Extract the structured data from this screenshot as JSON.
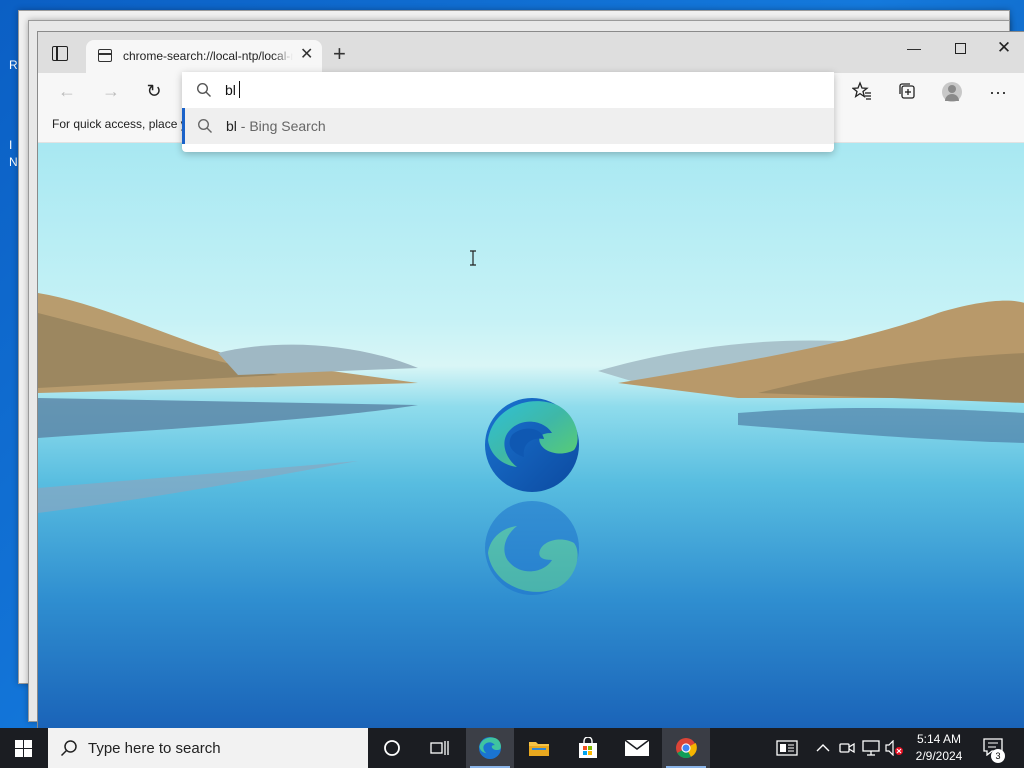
{
  "desktop": {
    "edge_letters": [
      "R",
      "I",
      "N"
    ]
  },
  "browser": {
    "tab": {
      "title": "chrome-search://local-ntp/local-ntp.html",
      "close": "✕"
    },
    "new_tab": "+",
    "window_controls": {
      "minimize": "—",
      "close": "✕"
    },
    "toolbar": {
      "back": "←",
      "forward": "→",
      "refresh": "↻",
      "more": "···"
    },
    "favbar_text": "For quick access, place y",
    "address_bar": {
      "value": "bl"
    },
    "suggestion": {
      "query": "bl",
      "description": " - Bing Search"
    }
  },
  "taskbar": {
    "search_placeholder": "Type here to search",
    "clock": {
      "time": "5:14 AM",
      "date": "2/9/2024"
    },
    "notification_count": "3"
  },
  "colors": {
    "accent": "#1a62c9",
    "taskbar_bg": "#1b1d22",
    "edge_blue": "#1a74d1",
    "edge_green": "#4cc36a"
  },
  "icons": [
    "tab-actions-icon",
    "page-icon",
    "search-icon",
    "back-icon",
    "forward-icon",
    "refresh-icon",
    "favorites-icon",
    "collections-icon",
    "profile-icon",
    "more-icon",
    "windows-start-icon",
    "cortana-icon",
    "task-view-icon",
    "edge-icon",
    "file-explorer-icon",
    "store-icon",
    "mail-icon",
    "chrome-icon",
    "news-icon",
    "chevron-up-icon",
    "meet-now-icon",
    "network-icon",
    "volume-muted-icon",
    "notification-icon"
  ]
}
